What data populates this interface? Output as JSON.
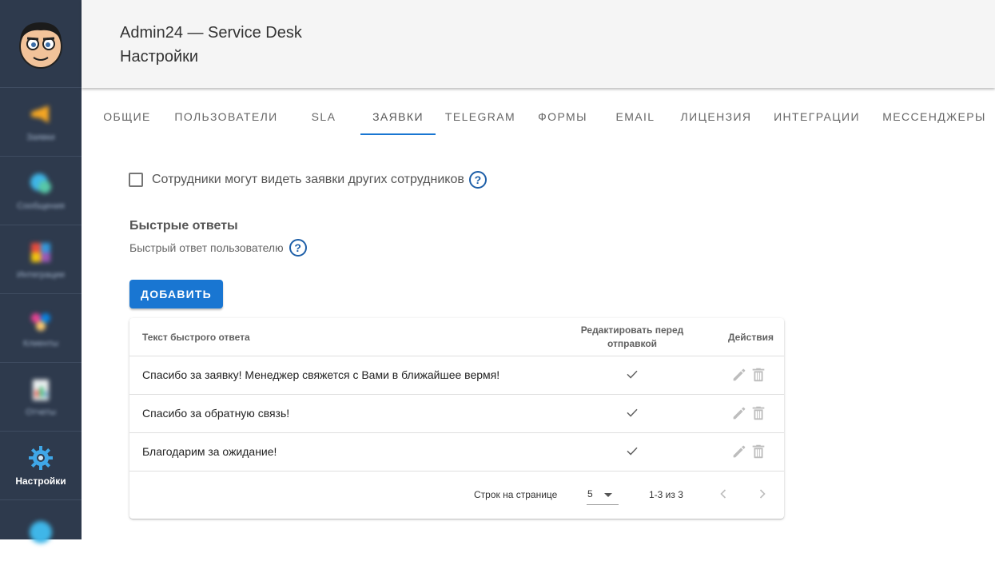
{
  "header": {
    "app_title": "Admin24 — Service Desk",
    "page_title": "Настройки"
  },
  "sidebar": {
    "items": [
      {
        "label": "Заявки",
        "icon": "megaphone-icon"
      },
      {
        "label": "Сообщения",
        "icon": "chat-bubble-icon"
      },
      {
        "label": "Интеграции",
        "icon": "puzzle-icon"
      },
      {
        "label": "Клиенты",
        "icon": "people-icon"
      },
      {
        "label": "Отчеты",
        "icon": "report-icon"
      },
      {
        "label": "Настройки",
        "icon": "gear-icon",
        "active": true
      },
      {
        "label": "",
        "icon": "globe-icon"
      }
    ]
  },
  "tabs": [
    {
      "label": "ОБЩИЕ"
    },
    {
      "label": "ПОЛЬЗОВАТЕЛИ"
    },
    {
      "label": "SLA"
    },
    {
      "label": "ЗАЯВКИ",
      "active": true
    },
    {
      "label": "TELEGRAM"
    },
    {
      "label": "ФОРМЫ"
    },
    {
      "label": "EMAIL"
    },
    {
      "label": "ЛИЦЕНЗИЯ"
    },
    {
      "label": "ИНТЕГРАЦИИ"
    },
    {
      "label": "МЕССЕНДЖЕРЫ"
    }
  ],
  "settings": {
    "see_others_tickets_label": "Сотрудники могут видеть заявки других сотрудников",
    "see_others_tickets_checked": false
  },
  "quick_replies": {
    "title": "Быстрые ответы",
    "subtitle": "Быстрый ответ пользователю",
    "add_button": "ДОБАВИТЬ",
    "columns": {
      "text": "Текст быстрого ответа",
      "edit_before_send": "Редактировать перед отправкой",
      "actions": "Действия"
    },
    "rows": [
      {
        "text": "Спасибо за заявку! Менеджер свяжется с Вами в ближайшее вермя!",
        "edit_before_send": true
      },
      {
        "text": "Спасибо за обратную связь!",
        "edit_before_send": true
      },
      {
        "text": "Благодарим за ожидание!",
        "edit_before_send": true
      }
    ],
    "pagination": {
      "rows_per_page_label": "Строк на странице",
      "rows_per_page": "5",
      "range": "1-3 из 3"
    }
  },
  "colors": {
    "sidebar_bg": "#2e3a4d",
    "accent": "#1976d2",
    "help_icon": "#1e5fa8"
  }
}
